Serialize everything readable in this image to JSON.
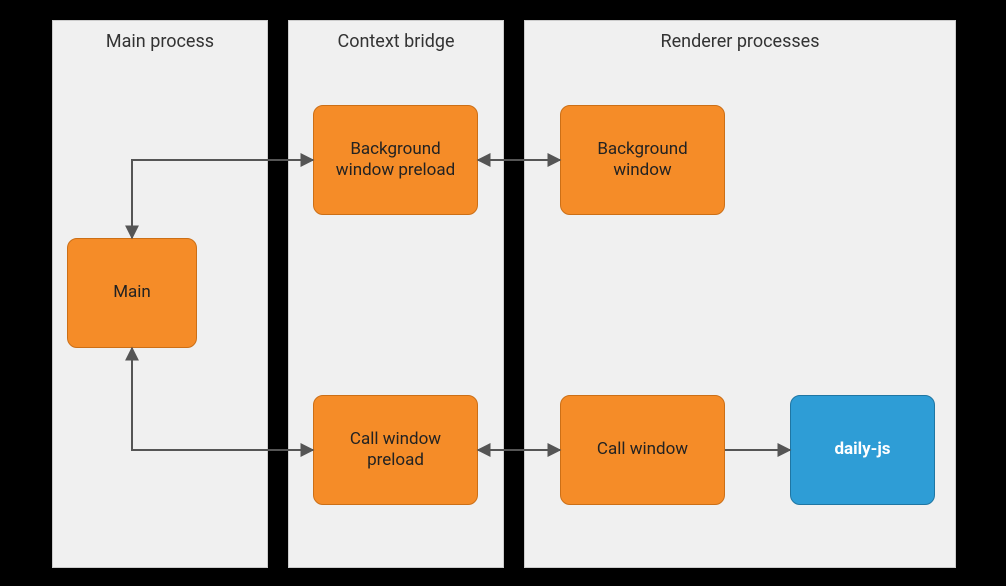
{
  "panels": {
    "main_process": {
      "title": "Main process"
    },
    "context_bridge": {
      "title": "Context bridge"
    },
    "renderer_processes": {
      "title": "Renderer processes"
    }
  },
  "nodes": {
    "main": {
      "label": "Main"
    },
    "bg_preload": {
      "label": "Background window preload"
    },
    "call_preload": {
      "label": "Call window preload"
    },
    "bg_window": {
      "label": "Background window"
    },
    "call_window": {
      "label": "Call window"
    },
    "daily_js": {
      "label": "daily-js"
    }
  },
  "chart_data": {
    "type": "diagram",
    "title": "",
    "groups": [
      {
        "id": "main_process",
        "label": "Main process",
        "nodes": [
          "main"
        ]
      },
      {
        "id": "context_bridge",
        "label": "Context bridge",
        "nodes": [
          "bg_preload",
          "call_preload"
        ]
      },
      {
        "id": "renderer_processes",
        "label": "Renderer processes",
        "nodes": [
          "bg_window",
          "call_window",
          "daily_js"
        ]
      }
    ],
    "nodes": [
      {
        "id": "main",
        "label": "Main",
        "color": "#f58c28"
      },
      {
        "id": "bg_preload",
        "label": "Background window preload",
        "color": "#f58c28"
      },
      {
        "id": "call_preload",
        "label": "Call window preload",
        "color": "#f58c28"
      },
      {
        "id": "bg_window",
        "label": "Background window",
        "color": "#f58c28"
      },
      {
        "id": "call_window",
        "label": "Call window",
        "color": "#f58c28"
      },
      {
        "id": "daily_js",
        "label": "daily-js",
        "color": "#2e9dd6"
      }
    ],
    "edges": [
      {
        "from": "main",
        "to": "bg_preload",
        "bidirectional": true
      },
      {
        "from": "main",
        "to": "call_preload",
        "bidirectional": true
      },
      {
        "from": "bg_preload",
        "to": "bg_window",
        "bidirectional": true
      },
      {
        "from": "call_preload",
        "to": "call_window",
        "bidirectional": true
      },
      {
        "from": "call_window",
        "to": "daily_js",
        "bidirectional": false
      }
    ]
  }
}
